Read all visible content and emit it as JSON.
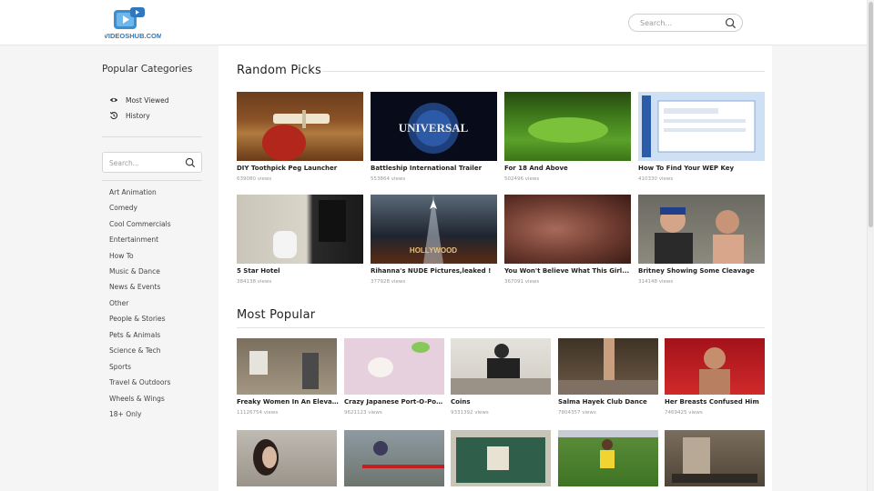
{
  "header": {
    "search_placeholder": "Search..."
  },
  "sidebar": {
    "title": "Popular Categories",
    "links": [
      {
        "label": "Most Viewed",
        "icon": "eye-icon"
      },
      {
        "label": "History",
        "icon": "history-icon"
      }
    ],
    "search_placeholder": "Search...",
    "categories": [
      "Art Animation",
      "Comedy",
      "Cool Commercials",
      "Entertainment",
      "How To",
      "Music & Dance",
      "News & Events",
      "Other",
      "People & Stories",
      "Pets & Animals",
      "Science & Tech",
      "Sports",
      "Travel & Outdoors",
      "Wheels & Wings",
      "18+ Only"
    ]
  },
  "random_picks": {
    "title": "Random Picks",
    "videos": [
      {
        "title": "DIY Toothpick Peg Launcher",
        "views": "639080 views"
      },
      {
        "title": "Battleship International Trailer",
        "views": "553864 views"
      },
      {
        "title": "For 18 And Above",
        "views": "502496 views"
      },
      {
        "title": "How To Find Your WEP Key",
        "views": "410330 views"
      },
      {
        "title": "5 Star Hotel",
        "views": "384138 views"
      },
      {
        "title": "Rihanna's NUDE Pictures,leaked !",
        "views": "377928 views"
      },
      {
        "title": "You Won't Believe What This Girl...",
        "views": "367091 views"
      },
      {
        "title": "Britney Showing Some Cleavage",
        "views": "314148 views"
      }
    ]
  },
  "most_popular": {
    "title": "Most Popular",
    "videos": [
      {
        "title": "Freaky Women In An Elevator",
        "views": "11126754 views"
      },
      {
        "title": "Crazy Japanese Port-O-Potty...",
        "views": "9621123 views"
      },
      {
        "title": "Coins",
        "views": "9331392 views"
      },
      {
        "title": "Salma Hayek Club Dance",
        "views": "7804357 views"
      },
      {
        "title": "Her Breasts Confused Him",
        "views": "7469425 views"
      }
    ]
  }
}
